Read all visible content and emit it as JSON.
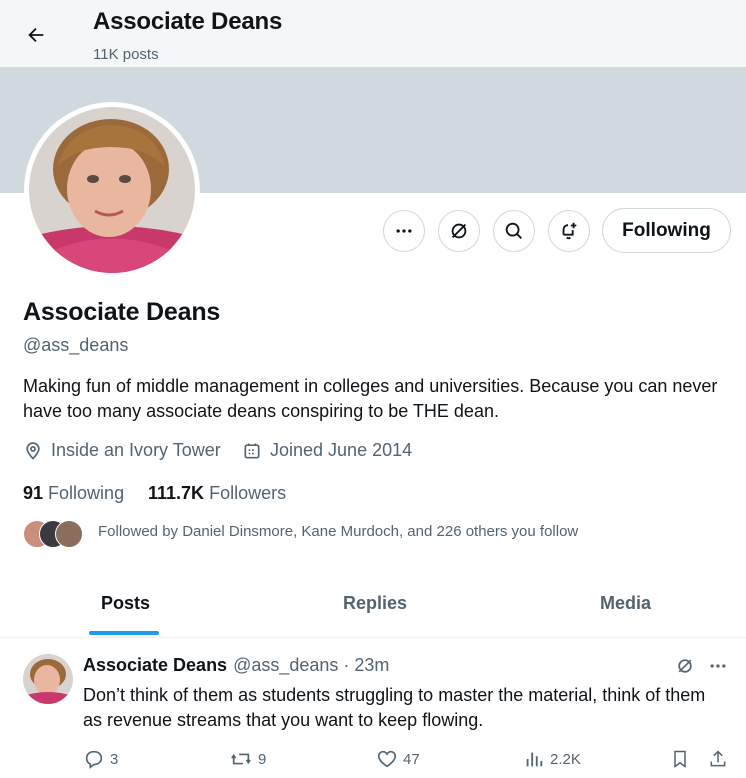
{
  "header": {
    "title": "Associate Deans",
    "post_count": "11K posts"
  },
  "profile": {
    "name": "Associate Deans",
    "handle": "@ass_deans",
    "bio": "Making fun of middle management in colleges and universities. Because you can never have too many associate deans conspiring to be THE dean.",
    "location": "Inside an Ivory Tower",
    "joined": "Joined June 2014",
    "following_count": "91",
    "following_label": "Following",
    "followers_count": "111.7K",
    "followers_label": "Followers",
    "followed_by": "Followed by Daniel Dinsmore, Kane Murdoch, and 226 others you follow",
    "follow_button": "Following"
  },
  "tabs": [
    {
      "label": "Posts",
      "active": true
    },
    {
      "label": "Replies",
      "active": false
    },
    {
      "label": "Media",
      "active": false
    }
  ],
  "post": {
    "author": "Associate Deans",
    "meta": "@ass_deans · 23m",
    "text": "Don’t think of them as students struggling to master the material, think of them as revenue streams that you want to keep flowing.",
    "replies": "3",
    "reposts": "9",
    "likes": "47",
    "views": "2.2K"
  },
  "colors": {
    "accent": "#1d9bf0",
    "secondary_text": "#536471",
    "banner": "#cfd9de",
    "header_bg": "#f5f6f7"
  },
  "icons": [
    "back-arrow-icon",
    "more-icon",
    "grok-icon",
    "search-icon",
    "notification-add-icon",
    "location-icon",
    "calendar-icon",
    "reply-icon",
    "repost-icon",
    "like-icon",
    "views-icon",
    "bookmark-icon",
    "share-icon"
  ]
}
